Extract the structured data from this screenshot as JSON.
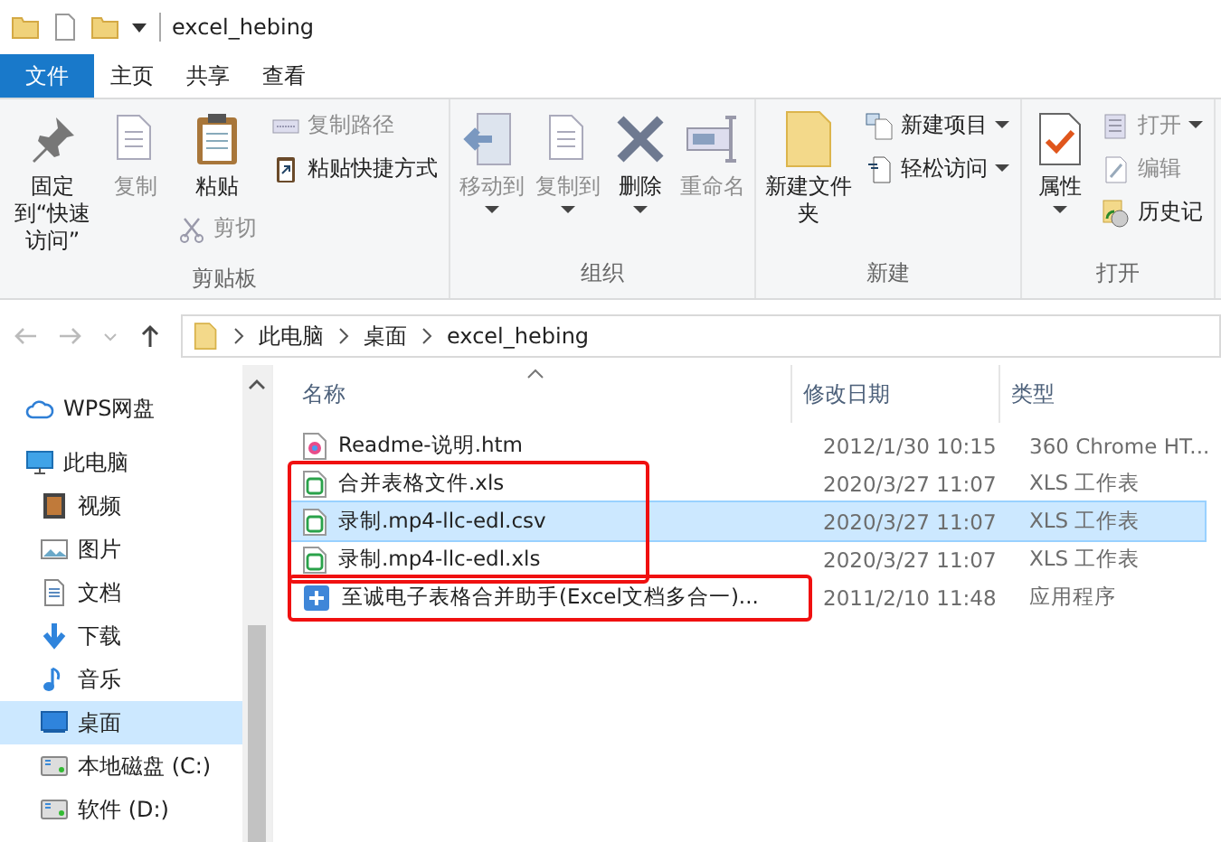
{
  "window": {
    "title": "excel_hebing"
  },
  "ribbon_tabs": [
    {
      "label": "文件",
      "kind": "file"
    },
    {
      "label": "主页",
      "kind": "tab"
    },
    {
      "label": "共享",
      "kind": "tab"
    },
    {
      "label": "查看",
      "kind": "tab"
    }
  ],
  "ribbon_groups": [
    {
      "label": "剪贴板",
      "columns": [
        [
          {
            "label": "固定到“快速访问”",
            "kind": "large",
            "disabled": false,
            "dropdown": false
          }
        ],
        [
          {
            "label": "复制",
            "kind": "large",
            "disabled": true,
            "dropdown": false
          }
        ],
        [
          {
            "label": "粘贴",
            "kind": "large",
            "disabled": false,
            "dropdown": false
          },
          {
            "label": "剪切",
            "kind": "small",
            "disabled": true,
            "dropdown": false
          }
        ],
        [
          {
            "label": "复制路径",
            "kind": "small",
            "disabled": true,
            "dropdown": false
          },
          {
            "label": "粘贴快捷方式",
            "kind": "small",
            "disabled": false,
            "dropdown": false
          }
        ]
      ]
    },
    {
      "label": "组织",
      "columns": [
        [
          {
            "label": "移动到",
            "kind": "large",
            "disabled": true,
            "dropdown": true
          }
        ],
        [
          {
            "label": "复制到",
            "kind": "large",
            "disabled": true,
            "dropdown": true
          }
        ],
        [
          {
            "label": "删除",
            "kind": "large",
            "disabled": false,
            "dropdown": true
          }
        ],
        [
          {
            "label": "重命名",
            "kind": "large",
            "disabled": true,
            "dropdown": false
          }
        ]
      ]
    },
    {
      "label": "新建",
      "columns": [
        [
          {
            "label": "新建文件夹",
            "kind": "large",
            "disabled": false,
            "dropdown": false
          }
        ],
        [
          {
            "label": "新建项目",
            "kind": "small",
            "disabled": false,
            "dropdown": true
          },
          {
            "label": "轻松访问",
            "kind": "small",
            "disabled": false,
            "dropdown": true
          }
        ]
      ]
    },
    {
      "label": "打开",
      "columns": [
        [
          {
            "label": "属性",
            "kind": "large",
            "disabled": false,
            "dropdown": true
          }
        ],
        [
          {
            "label": "打开",
            "kind": "small",
            "disabled": true,
            "dropdown": true
          },
          {
            "label": "编辑",
            "kind": "small",
            "disabled": true,
            "dropdown": false
          },
          {
            "label": "历史记",
            "kind": "small",
            "disabled": false,
            "dropdown": false
          }
        ]
      ]
    }
  ],
  "address_bar": {
    "path": [
      "此电脑",
      "桌面",
      "excel_hebing"
    ]
  },
  "sidebar": {
    "items": [
      {
        "label": "WPS网盘",
        "selected": false
      },
      {
        "label": "此电脑",
        "selected": false,
        "children": [
          {
            "label": "视频",
            "selected": false
          },
          {
            "label": "图片",
            "selected": false
          },
          {
            "label": "文档",
            "selected": false
          },
          {
            "label": "下载",
            "selected": false
          },
          {
            "label": "音乐",
            "selected": false
          },
          {
            "label": "桌面",
            "selected": true
          },
          {
            "label": "本地磁盘 (C:)",
            "selected": false
          },
          {
            "label": "软件 (D:)",
            "selected": false
          }
        ]
      }
    ]
  },
  "file_list": {
    "columns": [
      "名称",
      "修改日期",
      "类型"
    ],
    "groups": [
      {
        "boxed": false,
        "rows": [
          {
            "name": "Readme-说明.htm",
            "date": "2012/1/30 10:15",
            "type": "360 Chrome HT...",
            "selected": false,
            "kind": "web"
          }
        ]
      },
      {
        "boxed": true,
        "rows": [
          {
            "name": "合并表格文件.xls",
            "date": "2020/3/27 11:07",
            "type": "XLS 工作表",
            "selected": false,
            "kind": "sheet"
          },
          {
            "name": "录制.mp4-llc-edl.csv",
            "date": "2020/3/27 11:07",
            "type": "XLS 工作表",
            "selected": true,
            "kind": "sheet"
          },
          {
            "name": "录制.mp4-llc-edl.xls",
            "date": "2020/3/27 11:07",
            "type": "XLS 工作表",
            "selected": false,
            "kind": "sheet"
          }
        ]
      },
      {
        "boxed": true,
        "rows": [
          {
            "name": "至诚电子表格合并助手(Excel文档多合一)...",
            "date": "2011/2/10 11:48",
            "type": "应用程序",
            "selected": false,
            "kind": "app"
          }
        ]
      }
    ]
  }
}
